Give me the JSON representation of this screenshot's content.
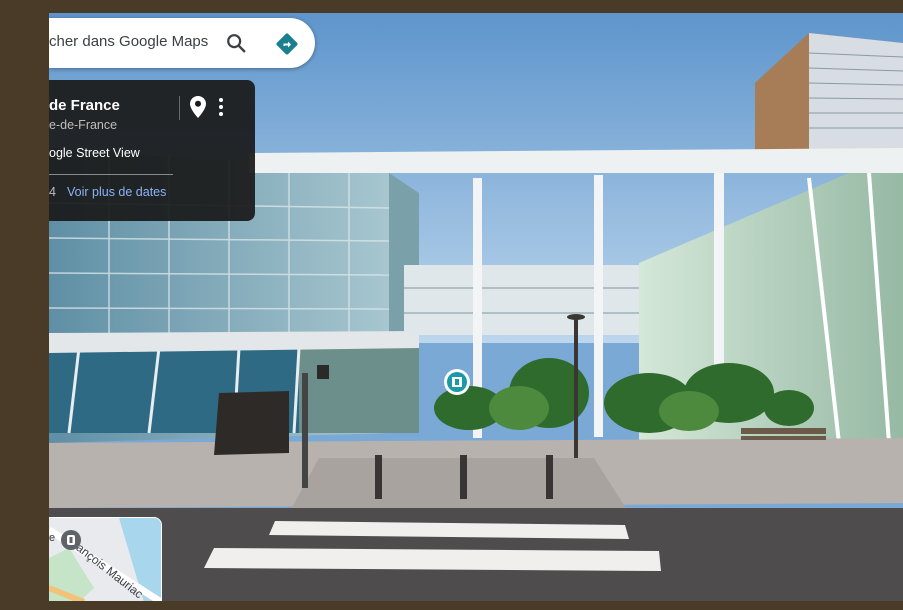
{
  "search": {
    "query_text": "cher dans Google Maps",
    "search_icon": "search-icon",
    "directions_icon": "directions-icon"
  },
  "place_card": {
    "title": "de France",
    "subtitle": "e-de-France",
    "source": "ogle Street View",
    "date": "4",
    "more_dates_link": "Voir plus de dates",
    "pin_icon": "map-pin-icon",
    "more_icon": "more-vertical-icon"
  },
  "minimap": {
    "street_label": "rançois Mauriac",
    "left_letter": "e",
    "pin_icon": "map-marker-icon"
  },
  "colors": {
    "accent_blue": "#1a73e8",
    "directions_teal": "#1a7f8e",
    "link_blue": "#8ab4f8",
    "card_bg": "#1a1a1a",
    "frame": "#4a3a28"
  }
}
